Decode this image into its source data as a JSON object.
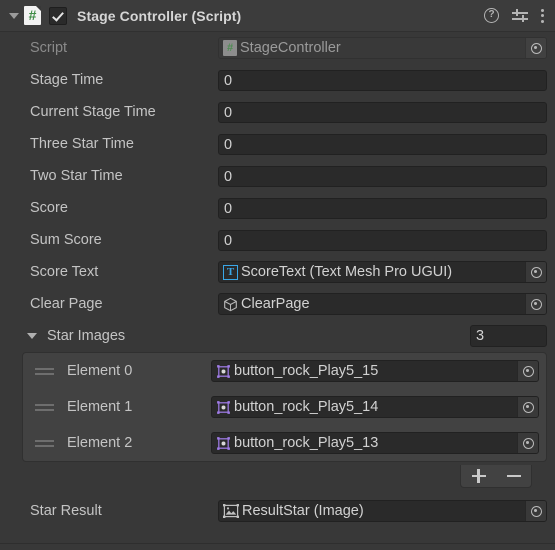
{
  "header": {
    "title": "Stage Controller (Script)",
    "enabled": true,
    "foldout_expanded": true,
    "icons": {
      "script": "csharp-script-icon",
      "checkbox": "enabled-checkbox",
      "help": "help-icon",
      "preset": "preset-icon",
      "menu": "kebab-menu-icon"
    }
  },
  "colors": {
    "window_bg": "#383838",
    "header_bg": "#3c3c3c",
    "field_bg": "#2a2a2a",
    "list_bg": "#424242",
    "label": "#c4c4c4",
    "label_dim": "#8a8a8a",
    "accent_tmp": "#39a7e8",
    "accent_sprite": "#a07ce8",
    "accent_script_green": "#4e8c52"
  },
  "properties": [
    {
      "label": "Script",
      "type": "object",
      "value": "StageController",
      "icon": "csharp-script-icon",
      "readonly": true
    },
    {
      "label": "Stage Time",
      "type": "number",
      "value": "0"
    },
    {
      "label": "Current Stage Time",
      "type": "number",
      "value": "0"
    },
    {
      "label": "Three Star Time",
      "type": "number",
      "value": "0"
    },
    {
      "label": "Two Star Time",
      "type": "number",
      "value": "0"
    },
    {
      "label": "Score",
      "type": "number",
      "value": "0"
    },
    {
      "label": "Sum Score",
      "type": "number",
      "value": "0"
    },
    {
      "label": "Score Text",
      "type": "object",
      "value": "ScoreText (Text Mesh Pro UGUI)",
      "icon": "textmeshpro-icon"
    },
    {
      "label": "Clear Page",
      "type": "object",
      "value": "ClearPage",
      "icon": "gameobject-cube-icon"
    }
  ],
  "array": {
    "label": "Star Images",
    "expanded": true,
    "size": "3",
    "elements": [
      {
        "label": "Element 0",
        "value": "button_rock_Play5_15",
        "icon": "sprite-icon"
      },
      {
        "label": "Element 1",
        "value": "button_rock_Play5_14",
        "icon": "sprite-icon"
      },
      {
        "label": "Element 2",
        "value": "button_rock_Play5_13",
        "icon": "sprite-icon"
      }
    ],
    "footer": {
      "add_label": "+",
      "remove_label": "−"
    }
  },
  "trailing": [
    {
      "label": "Star Result",
      "type": "object",
      "value": "ResultStar (Image)",
      "icon": "image-component-icon"
    }
  ]
}
